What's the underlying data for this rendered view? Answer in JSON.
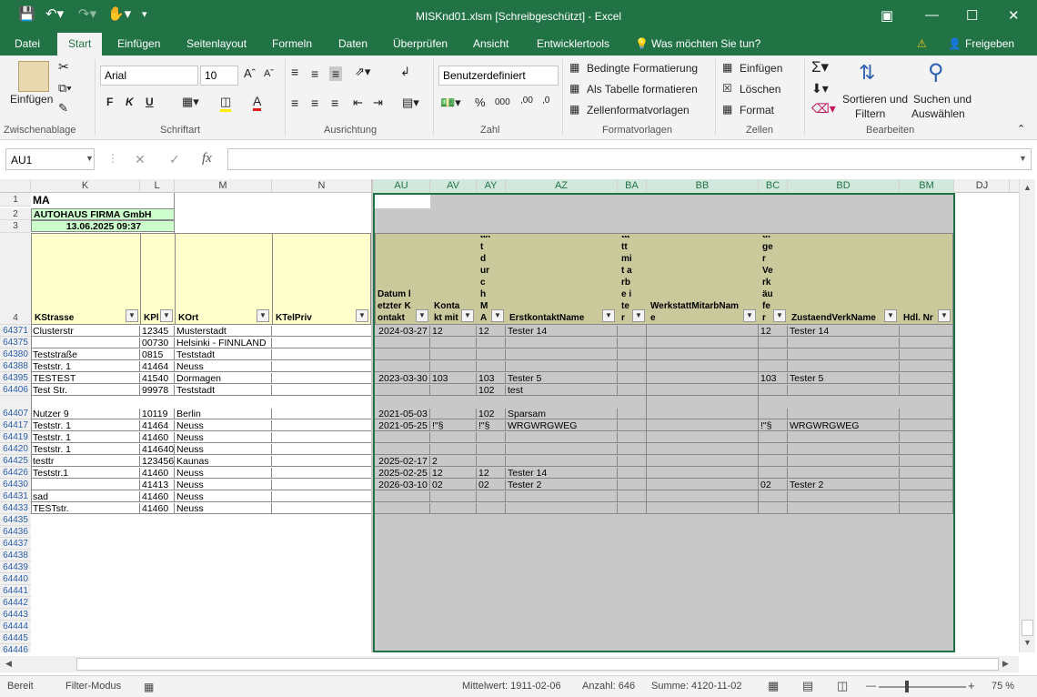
{
  "window": {
    "title": "MISKnd01.xlsm  [Schreibgeschützt] - Excel"
  },
  "tabs": [
    "Datei",
    "Start",
    "Einfügen",
    "Seitenlayout",
    "Formeln",
    "Daten",
    "Überprüfen",
    "Ansicht",
    "Entwicklertools"
  ],
  "tell_me": "Was möchten Sie tun?",
  "share": "Freigeben",
  "ribbon": {
    "paste": "Einfügen",
    "font_name": "Arial",
    "font_size": "10",
    "number_format": "Benutzerdefiniert",
    "bold": "F",
    "italic": "K",
    "underline": "U",
    "cond_format": "Bedingte Formatierung",
    "as_table": "Als Tabelle formatieren",
    "cell_styles": "Zellenformatvorlagen",
    "insert": "Einfügen",
    "delete": "Löschen",
    "format": "Format",
    "sort": "Sortieren und",
    "sort2": "Filtern",
    "find": "Suchen und",
    "find2": "Auswählen",
    "groups": [
      "Zwischenablage",
      "Schriftart",
      "Ausrichtung",
      "Zahl",
      "Formatvorlagen",
      "Zellen",
      "Bearbeiten"
    ]
  },
  "formula_bar": {
    "name_box": "AU1",
    "formula": ""
  },
  "columns": [
    "K",
    "L",
    "M",
    "N",
    "AU",
    "AV",
    "AY",
    "AZ",
    "BA",
    "BB",
    "BC",
    "BD",
    "BM",
    "DJ"
  ],
  "header_cells": {
    "title": "MA",
    "company": "AUTOHAUS FIRMA GmbH",
    "datetime": "13.06.2025 09:37"
  },
  "table_headers": {
    "K": "KStrasse",
    "L": "KPl",
    "M": "KOrt",
    "N": "KTelPriv",
    "AU": "Datum letzter Kontakt",
    "AV": "Kontakt mit",
    "AY": "Erst kont akt durc h MA",
    "AZ": "ErstkontaktName",
    "BA": "Zust ändi ger Wer ksta ttmit arbe iter",
    "BB": "WerkstattMitarbName",
    "BC": "Zust ändi ger Verk äufe r",
    "BD": "ZustaendVerkName",
    "BM": "Hdl. Nr"
  },
  "rows": [
    {
      "id": "64371",
      "k": "Clusterstr",
      "l": "12345",
      "m": "Musterstadt",
      "au": "2024-03-27",
      "av": "12",
      "ay": "12",
      "az": "Tester 14",
      "bc": "12",
      "bd": "Tester 14"
    },
    {
      "id": "64375",
      "k": "",
      "l": "00730",
      "m": "Helsinki - FINNLAND",
      "au": "",
      "av": "",
      "ay": "",
      "az": "",
      "bc": "",
      "bd": ""
    },
    {
      "id": "64380",
      "k": "Teststraße",
      "l": "0815",
      "m": "Teststadt",
      "au": "",
      "av": "",
      "ay": "",
      "az": "",
      "bc": "",
      "bd": ""
    },
    {
      "id": "64388",
      "k": "Teststr. 1",
      "l": "41464",
      "m": "Neuss",
      "au": "",
      "av": "",
      "ay": "",
      "az": "",
      "bc": "",
      "bd": ""
    },
    {
      "id": "64395",
      "k": "TESTEST",
      "l": "41540",
      "m": "Dormagen",
      "au": "2023-03-30",
      "av": "103",
      "ay": "103",
      "az": "Tester 5",
      "bc": "103",
      "bd": "Tester 5"
    },
    {
      "id": "64406",
      "k": "Test Str.",
      "l": "99978",
      "m": "Teststadt",
      "au": "",
      "av": "",
      "ay": "102",
      "az": "test",
      "bc": "",
      "bd": ""
    },
    {
      "id": "64407",
      "k": "Nutzer 9",
      "l": "10119",
      "m": "Berlin",
      "au": "2021-05-03",
      "av": "",
      "ay": "102",
      "az": "Sparsam",
      "bc": "",
      "bd": ""
    },
    {
      "id": "64417",
      "k": "Teststr. 1",
      "l": "41464",
      "m": "Neuss",
      "au": "2021-05-25",
      "av": "!\"§",
      "ay": "!\"§",
      "az": "WRGWRGWEG",
      "bc": "!\"§",
      "bd": "WRGWRGWEG"
    },
    {
      "id": "64419",
      "k": "Teststr. 1",
      "l": "41460",
      "m": "Neuss",
      "au": "",
      "av": "",
      "ay": "",
      "az": "",
      "bc": "",
      "bd": ""
    },
    {
      "id": "64420",
      "k": "Teststr. 1",
      "l": "414640",
      "m": "Neuss",
      "au": "",
      "av": "",
      "ay": "",
      "az": "",
      "bc": "",
      "bd": ""
    },
    {
      "id": "64425",
      "k": "testtr",
      "l": "123456",
      "m": "Kaunas",
      "au": "2025-02-17",
      "av": "2",
      "ay": "",
      "az": "",
      "bc": "",
      "bd": ""
    },
    {
      "id": "64426",
      "k": "Teststr.1",
      "l": "41460",
      "m": "Neuss",
      "au": "2025-02-25",
      "av": "12",
      "ay": "12",
      "az": "Tester 14",
      "bc": "",
      "bd": ""
    },
    {
      "id": "64430",
      "k": "",
      "l": "41413",
      "m": "Neuss",
      "au": "2026-03-10",
      "av": "02",
      "ay": "02",
      "az": "Tester 2",
      "bc": "02",
      "bd": "Tester 2"
    },
    {
      "id": "64431",
      "k": "sad",
      "l": "41460",
      "m": "Neuss",
      "au": "",
      "av": "",
      "ay": "",
      "az": "",
      "bc": "",
      "bd": ""
    },
    {
      "id": "64433",
      "k": "TESTstr.",
      "l": "41460",
      "m": "Neuss",
      "au": "",
      "av": "",
      "ay": "",
      "az": "",
      "bc": "",
      "bd": ""
    }
  ],
  "empty_rows": [
    "64435",
    "64436",
    "64437",
    "64438",
    "64439",
    "64440",
    "64441",
    "64442",
    "64443",
    "64444",
    "64445",
    "64446"
  ],
  "row_labels_top": [
    "1",
    "2",
    "3",
    "4"
  ],
  "status": {
    "ready": "Bereit",
    "filter": "Filter-Modus",
    "avg": "Mittelwert: 1911-02-06",
    "count": "Anzahl: 646",
    "sum": "Summe: 4120-11-02",
    "zoom": "75 %"
  }
}
